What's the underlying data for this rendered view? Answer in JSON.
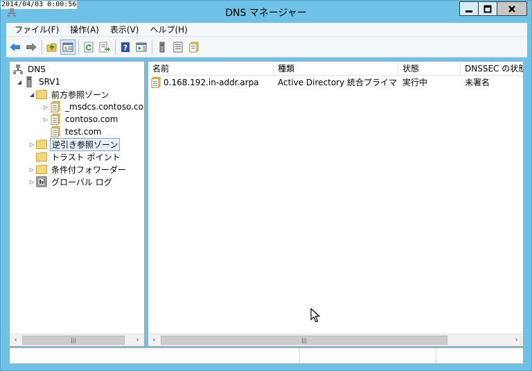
{
  "timestamp": "2014/04/03 0:00:56",
  "window": {
    "title": "DNS マネージャー",
    "minimize": "▬",
    "maximize": "□",
    "close": "✕"
  },
  "menu": {
    "items": [
      "ファイル(F)",
      "操作(A)",
      "表示(V)",
      "ヘルプ(H)"
    ]
  },
  "toolbar": {
    "buttons": [
      "back-arrow-icon",
      "forward-arrow-icon",
      "up-folder-icon",
      "show-hide-tree-icon",
      "refresh-icon",
      "export-list-icon",
      "help-icon",
      "action-pane-icon",
      "server-icon",
      "list-icon",
      "properties-icon"
    ]
  },
  "tree": {
    "items": [
      {
        "label": "DNS",
        "level": 0,
        "expander": "",
        "icon": "dns-icon"
      },
      {
        "label": "SRV1",
        "level": 1,
        "expander": "◢",
        "icon": "server-icon"
      },
      {
        "label": "前方参照ゾーン",
        "level": 2,
        "expander": "◢",
        "icon": "folder-icon"
      },
      {
        "label": "_msdcs.contoso.co",
        "level": 3,
        "expander": "▷",
        "icon": "zone-icon"
      },
      {
        "label": "contoso.com",
        "level": 3,
        "expander": "▷",
        "icon": "zone-icon"
      },
      {
        "label": "test.com",
        "level": 3,
        "expander": "",
        "icon": "zone-icon"
      },
      {
        "label": "逆引き参照ゾーン",
        "level": 2,
        "expander": "▷",
        "icon": "folder-icon",
        "selected": true
      },
      {
        "label": "トラスト ポイント",
        "level": 2,
        "expander": "",
        "icon": "folder-icon"
      },
      {
        "label": "条件付フォワーダー",
        "level": 2,
        "expander": "▷",
        "icon": "folder-icon"
      },
      {
        "label": "グローバル ログ",
        "level": 2,
        "expander": "▷",
        "icon": "log-icon"
      }
    ]
  },
  "list": {
    "columns": [
      "名前",
      "種類",
      "状態",
      "DNSSEC の状態"
    ],
    "rows": [
      {
        "name": "0.168.192.in-addr.arpa",
        "type": "Active Directory 統合プライマリ",
        "status": "実行中",
        "dnssec": "未署名"
      }
    ]
  },
  "scrollbar": {
    "left": "‹",
    "right": "›",
    "grip": "|||"
  }
}
